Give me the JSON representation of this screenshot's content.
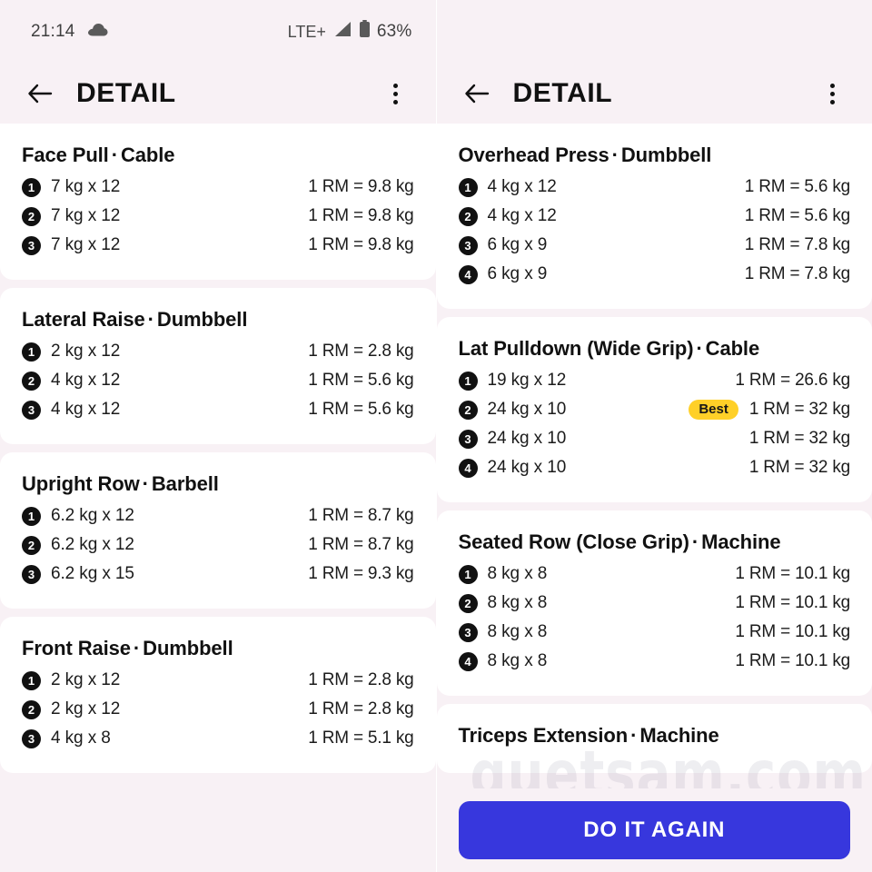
{
  "statusbar": {
    "time": "21:14",
    "cloud_icon": "cloud-icon",
    "network": "LTE+",
    "signal_icon": "signal-bars-icon",
    "battery_icon": "battery-icon",
    "battery": "63%"
  },
  "colors": {
    "page_background": "#f8f1f5",
    "card_background": "#ffffff",
    "text_primary": "#111111",
    "cta_blue": "#3737dd",
    "best_badge_yellow": "#ffd028"
  },
  "left_panel": {
    "appbar": {
      "back_icon": "back-arrow-icon",
      "title": "DETAIL",
      "overflow_icon": "more-vertical-icon"
    },
    "exercises": [
      {
        "name": "Face Pull",
        "separator": "·",
        "equipment": "Cable",
        "sets": [
          {
            "index": "1",
            "load": "7 kg x 12",
            "rm": "1 RM = 9.8 kg",
            "best": false
          },
          {
            "index": "2",
            "load": "7 kg x 12",
            "rm": "1 RM = 9.8 kg",
            "best": false
          },
          {
            "index": "3",
            "load": "7 kg x 12",
            "rm": "1 RM = 9.8 kg",
            "best": false
          }
        ]
      },
      {
        "name": "Lateral Raise",
        "separator": "·",
        "equipment": "Dumbbell",
        "sets": [
          {
            "index": "1",
            "load": "2 kg x 12",
            "rm": "1 RM = 2.8 kg",
            "best": false
          },
          {
            "index": "2",
            "load": "4 kg x 12",
            "rm": "1 RM = 5.6 kg",
            "best": false
          },
          {
            "index": "3",
            "load": "4 kg x 12",
            "rm": "1 RM = 5.6 kg",
            "best": false
          }
        ]
      },
      {
        "name": "Upright Row",
        "separator": "·",
        "equipment": "Barbell",
        "sets": [
          {
            "index": "1",
            "load": "6.2 kg x 12",
            "rm": "1 RM = 8.7 kg",
            "best": false
          },
          {
            "index": "2",
            "load": "6.2 kg x 12",
            "rm": "1 RM = 8.7 kg",
            "best": false
          },
          {
            "index": "3",
            "load": "6.2 kg x 15",
            "rm": "1 RM = 9.3 kg",
            "best": false
          }
        ]
      },
      {
        "name": "Front Raise",
        "separator": "·",
        "equipment": "Dumbbell",
        "sets": [
          {
            "index": "1",
            "load": "2 kg x 12",
            "rm": "1 RM = 2.8 kg",
            "best": false
          },
          {
            "index": "2",
            "load": "2 kg x 12",
            "rm": "1 RM = 2.8 kg",
            "best": false
          },
          {
            "index": "3",
            "load": "4 kg x 8",
            "rm": "1 RM = 5.1 kg",
            "best": false
          }
        ]
      }
    ]
  },
  "right_panel": {
    "appbar": {
      "back_icon": "back-arrow-icon",
      "title": "DETAIL",
      "overflow_icon": "more-vertical-icon"
    },
    "exercises": [
      {
        "name": "Overhead Press",
        "separator": "·",
        "equipment": "Dumbbell",
        "sets": [
          {
            "index": "1",
            "load": "4 kg x 12",
            "rm": "1 RM = 5.6 kg",
            "best": false
          },
          {
            "index": "2",
            "load": "4 kg x 12",
            "rm": "1 RM = 5.6 kg",
            "best": false
          },
          {
            "index": "3",
            "load": "6 kg x 9",
            "rm": "1 RM = 7.8 kg",
            "best": false
          },
          {
            "index": "4",
            "load": "6 kg x 9",
            "rm": "1 RM = 7.8 kg",
            "best": false
          }
        ]
      },
      {
        "name": "Lat Pulldown (Wide Grip)",
        "separator": "·",
        "equipment": "Cable",
        "sets": [
          {
            "index": "1",
            "load": "19 kg x 12",
            "rm": "1 RM = 26.6 kg",
            "best": false
          },
          {
            "index": "2",
            "load": "24 kg x 10",
            "rm": "1 RM = 32 kg",
            "best": true,
            "best_label": "Best"
          },
          {
            "index": "3",
            "load": "24 kg x 10",
            "rm": "1 RM = 32 kg",
            "best": false
          },
          {
            "index": "4",
            "load": "24 kg x 10",
            "rm": "1 RM = 32 kg",
            "best": false
          }
        ]
      },
      {
        "name": "Seated Row (Close Grip)",
        "separator": "·",
        "equipment": "Machine",
        "sets": [
          {
            "index": "1",
            "load": "8 kg x 8",
            "rm": "1 RM = 10.1 kg",
            "best": false
          },
          {
            "index": "2",
            "load": "8 kg x 8",
            "rm": "1 RM = 10.1 kg",
            "best": false
          },
          {
            "index": "3",
            "load": "8 kg x 8",
            "rm": "1 RM = 10.1 kg",
            "best": false
          },
          {
            "index": "4",
            "load": "8 kg x 8",
            "rm": "1 RM = 10.1 kg",
            "best": false
          }
        ]
      },
      {
        "name": "Triceps Extension",
        "separator": "·",
        "equipment": "Machine",
        "sets": []
      }
    ],
    "cta_label": "DO IT AGAIN",
    "watermark": "quetsam.com"
  }
}
